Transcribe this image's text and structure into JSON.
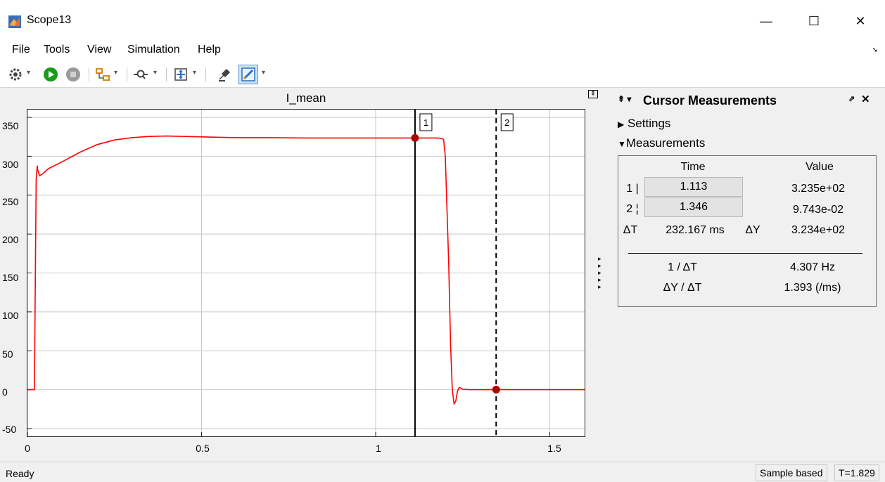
{
  "window": {
    "title": "Scope13",
    "minimize": "—",
    "maximize": "☐",
    "close": "✕"
  },
  "menu": [
    "File",
    "Tools",
    "View",
    "Simulation",
    "Help"
  ],
  "toolbar": {
    "icons": [
      "gear-icon",
      "run-icon",
      "stop-icon",
      "signal-routing-icon",
      "zoom-icon",
      "autoscale-icon",
      "highlight-icon",
      "cursor-measurements-icon"
    ]
  },
  "colors": {
    "signal": "#ff0000",
    "marker": "#b00000",
    "run_green": "#1a9c1a",
    "toolbar_blue": "#2b6fc2"
  },
  "chart_data": {
    "type": "line",
    "title": "I_mean",
    "xlabel": "",
    "ylabel": "",
    "xlim": [
      0,
      1.6
    ],
    "ylim": [
      -60,
      360
    ],
    "xticks": [
      "0",
      "0.5",
      "1",
      "1.5"
    ],
    "yticks": [
      "-50",
      "0",
      "50",
      "100",
      "150",
      "200",
      "250",
      "300",
      "350"
    ],
    "grid": true,
    "series": [
      {
        "x": [
          0,
          0.02,
          0.025,
          0.028,
          0.03,
          0.035,
          0.045,
          0.06,
          0.1,
          0.15,
          0.2,
          0.25,
          0.3,
          0.35,
          0.4,
          0.5,
          0.6,
          0.7,
          0.8,
          0.9,
          1.0,
          1.1,
          1.113,
          1.15,
          1.18,
          1.195,
          1.2,
          1.21,
          1.215,
          1.22,
          1.225,
          1.23,
          1.235,
          1.24,
          1.25,
          1.27,
          1.3,
          1.346,
          1.4,
          1.5,
          1.6
        ],
        "y": [
          0,
          0,
          270,
          288,
          282,
          275,
          278,
          284,
          293,
          305,
          315,
          321,
          324,
          325.5,
          326,
          325,
          324,
          324,
          323.5,
          323.5,
          323.5,
          323.5,
          323.5,
          323.5,
          323.5,
          322,
          300,
          160,
          60,
          0,
          -18,
          -15,
          -2,
          3,
          0.5,
          0,
          0,
          0.1,
          0,
          0,
          0
        ]
      }
    ],
    "cursors": [
      {
        "label": "1",
        "x": 1.113,
        "y": 323.5,
        "style": "solid"
      },
      {
        "label": "2",
        "x": 1.346,
        "y": 0.1,
        "style": "dashed"
      }
    ]
  },
  "panel": {
    "title": "Cursor Measurements",
    "settings_label": "Settings",
    "measurements_label": "Measurements",
    "col_time": "Time",
    "col_value": "Value",
    "row1_label": "1 |",
    "row1_time": "1.113",
    "row1_value": "3.235e+02",
    "row2_label": "2 ¦",
    "row2_time": "1.346",
    "row2_value": "9.743e-02",
    "dt_label": "ΔT",
    "dt_value": "232.167 ms",
    "dy_label": "ΔY",
    "dy_value": "3.234e+02",
    "inv_dt_label": "1 / ΔT",
    "inv_dt_value": "4.307 Hz",
    "slope_label": "ΔY / ΔT",
    "slope_value": "1.393 (/ms)"
  },
  "status": {
    "ready": "Ready",
    "mode": "Sample based",
    "time": "T=1.829"
  }
}
